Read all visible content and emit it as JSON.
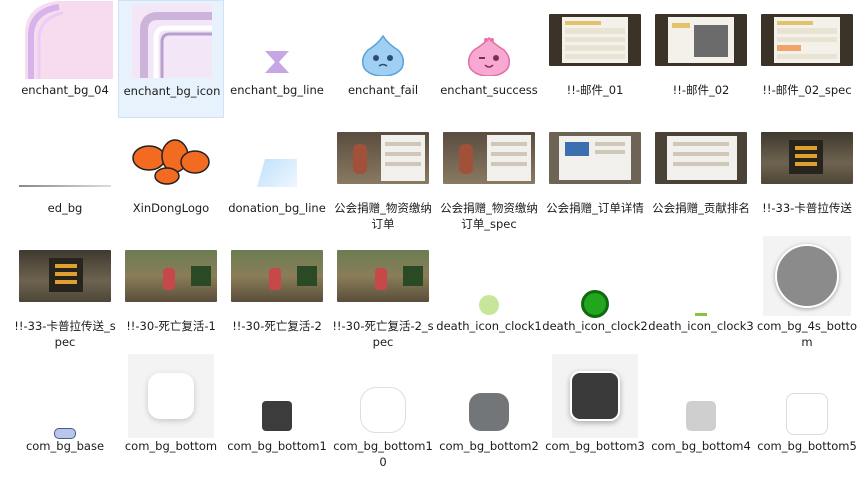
{
  "files": [
    {
      "name": "enchant_bg_04",
      "thumb": "enchant-bg-04-thumb"
    },
    {
      "name": "enchant_bg_icon",
      "thumb": "enchant-bg-icon-thumb",
      "selected": true
    },
    {
      "name": "enchant_bg_line",
      "thumb": "hourglass-thumb"
    },
    {
      "name": "enchant_fail",
      "thumb": "blue-slime-thumb"
    },
    {
      "name": "enchant_success",
      "thumb": "pink-slime-thumb"
    },
    {
      "name": "!!-邮件_01",
      "thumb": "mail-ui-screenshot-thumb"
    },
    {
      "name": "!!-邮件_02",
      "thumb": "mail-ui-screenshot-thumb"
    },
    {
      "name": "!!-邮件_02_spec",
      "thumb": "mail-ui-screenshot-thumb"
    },
    {
      "name": "ed_bg",
      "thumb": "line-thumb"
    },
    {
      "name": "XinDongLogo",
      "thumb": "xindong-logo-thumb"
    },
    {
      "name": "donation_bg_line",
      "thumb": "blue-gradient-thumb"
    },
    {
      "name": "公会捐赠_物资缴纳订单",
      "thumb": "game-ui-screenshot-thumb"
    },
    {
      "name": "公会捐赠_物资缴纳订单_spec",
      "thumb": "game-ui-screenshot-thumb"
    },
    {
      "name": "公会捐赠_订单详情",
      "thumb": "game-ui-screenshot-thumb"
    },
    {
      "name": "公会捐赠_贡献排名",
      "thumb": "game-ui-screenshot-thumb"
    },
    {
      "name": "!!-33-卡普拉传送",
      "thumb": "game-scene-screenshot-thumb"
    },
    {
      "name": "!!-33-卡普拉传送_spec",
      "thumb": "game-scene-screenshot-thumb"
    },
    {
      "name": "!!-30-死亡复活-1",
      "thumb": "game-scene-screenshot-thumb"
    },
    {
      "name": "!!-30-死亡复活-2",
      "thumb": "game-scene-screenshot-thumb"
    },
    {
      "name": "!!-30-死亡复活-2_spec",
      "thumb": "game-scene-screenshot-thumb"
    },
    {
      "name": "death_icon_clock1",
      "thumb": "light-green-circle-thumb"
    },
    {
      "name": "death_icon_clock2",
      "thumb": "green-circle-thumb"
    },
    {
      "name": "death_icon_clock3",
      "thumb": "tiny-green-thumb"
    },
    {
      "name": "com_bg_4s_bottom",
      "thumb": "gray-circle-button-thumb"
    },
    {
      "name": "com_bg_base",
      "thumb": "pill-button-thumb"
    },
    {
      "name": "com_bg_bottom",
      "thumb": "white-rounded-square-thumb"
    },
    {
      "name": "com_bg_bottom1",
      "thumb": "dark-square-thumb"
    },
    {
      "name": "com_bg_bottom10",
      "thumb": "white-circle-thumb"
    },
    {
      "name": "com_bg_bottom2",
      "thumb": "gray-rounded-square-thumb"
    },
    {
      "name": "com_bg_bottom3",
      "thumb": "dark-rounded-square-thumb"
    },
    {
      "name": "com_bg_bottom4",
      "thumb": "light-gray-square-thumb"
    },
    {
      "name": "com_bg_bottom5",
      "thumb": "white-square-thumb"
    }
  ]
}
